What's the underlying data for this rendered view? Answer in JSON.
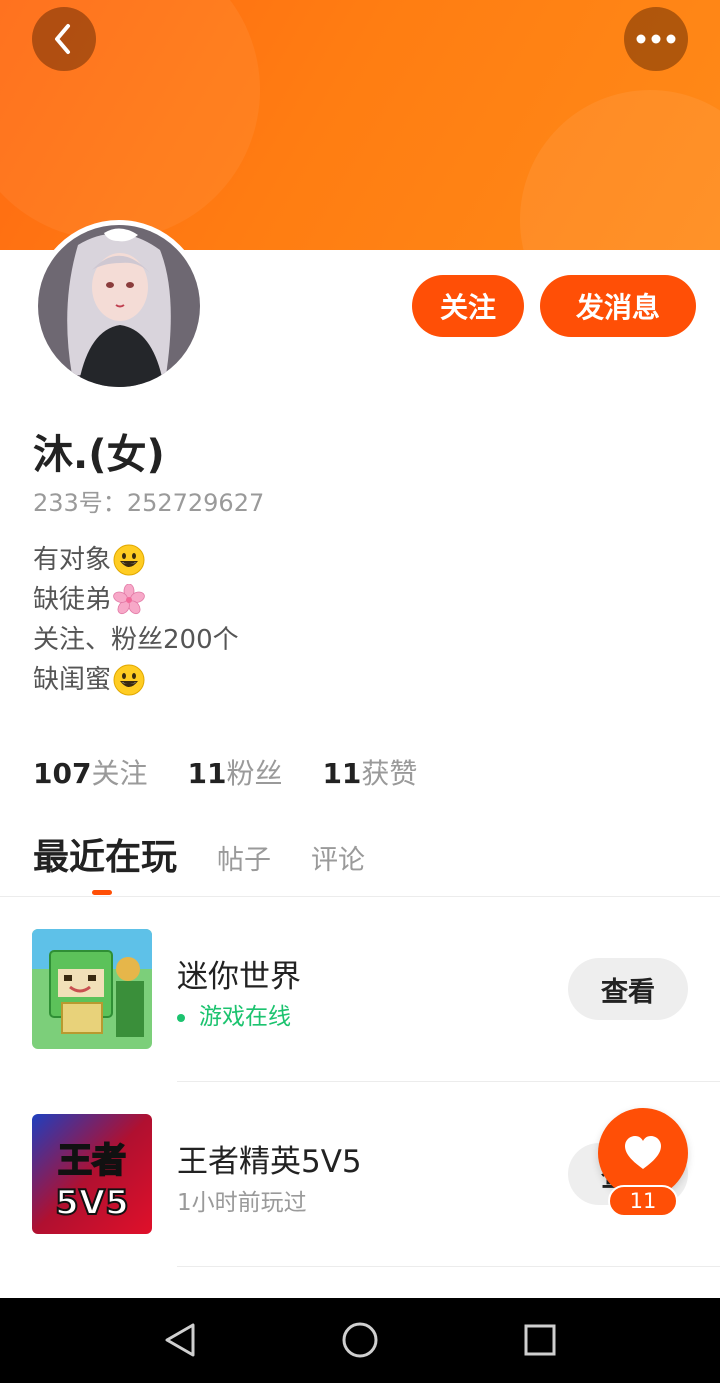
{
  "header": {
    "back_icon": "chevron-left-icon",
    "more_icon": "more-dots-icon",
    "banner_color": "#ff7412"
  },
  "profile": {
    "avatar": "avatar",
    "follow_label": "关注",
    "message_label": "发消息",
    "nickname": "沐.(女)",
    "uid_label": "233号：",
    "uid_value": "252729627",
    "bio": [
      {
        "text": "有对象",
        "emoji": "grinning-emoji"
      },
      {
        "text": "缺徒弟",
        "emoji": "cherry-blossom-emoji"
      },
      {
        "text": "关注、粉丝200个",
        "emoji": ""
      },
      {
        "text": "缺闺蜜",
        "emoji": "grinning-emoji"
      }
    ],
    "accent_color": "#ff4f06"
  },
  "stats": [
    {
      "value": "107",
      "label": "关注"
    },
    {
      "value": "11",
      "label": "粉丝"
    },
    {
      "value": "11",
      "label": "获赞"
    }
  ],
  "tabs": [
    {
      "label": "最近在玩",
      "active": true
    },
    {
      "label": "帖子",
      "active": false
    },
    {
      "label": "评论",
      "active": false
    }
  ],
  "games": [
    {
      "name": "迷你世界",
      "status": "游戏在线",
      "online": true,
      "action": "查看",
      "icon": "mini-world-game-icon"
    },
    {
      "name": "王者精英5V5",
      "status": "1小时前玩过",
      "online": false,
      "action": "查看",
      "icon": "wangzhe-5v5-game-icon",
      "thumb_text_1": "王者",
      "thumb_text_2": "5V5"
    }
  ],
  "like_fab": {
    "icon": "heart-icon",
    "count": "11"
  },
  "system_nav": {
    "back": "nav-back-icon",
    "home": "nav-home-icon",
    "recents": "nav-recents-icon"
  }
}
